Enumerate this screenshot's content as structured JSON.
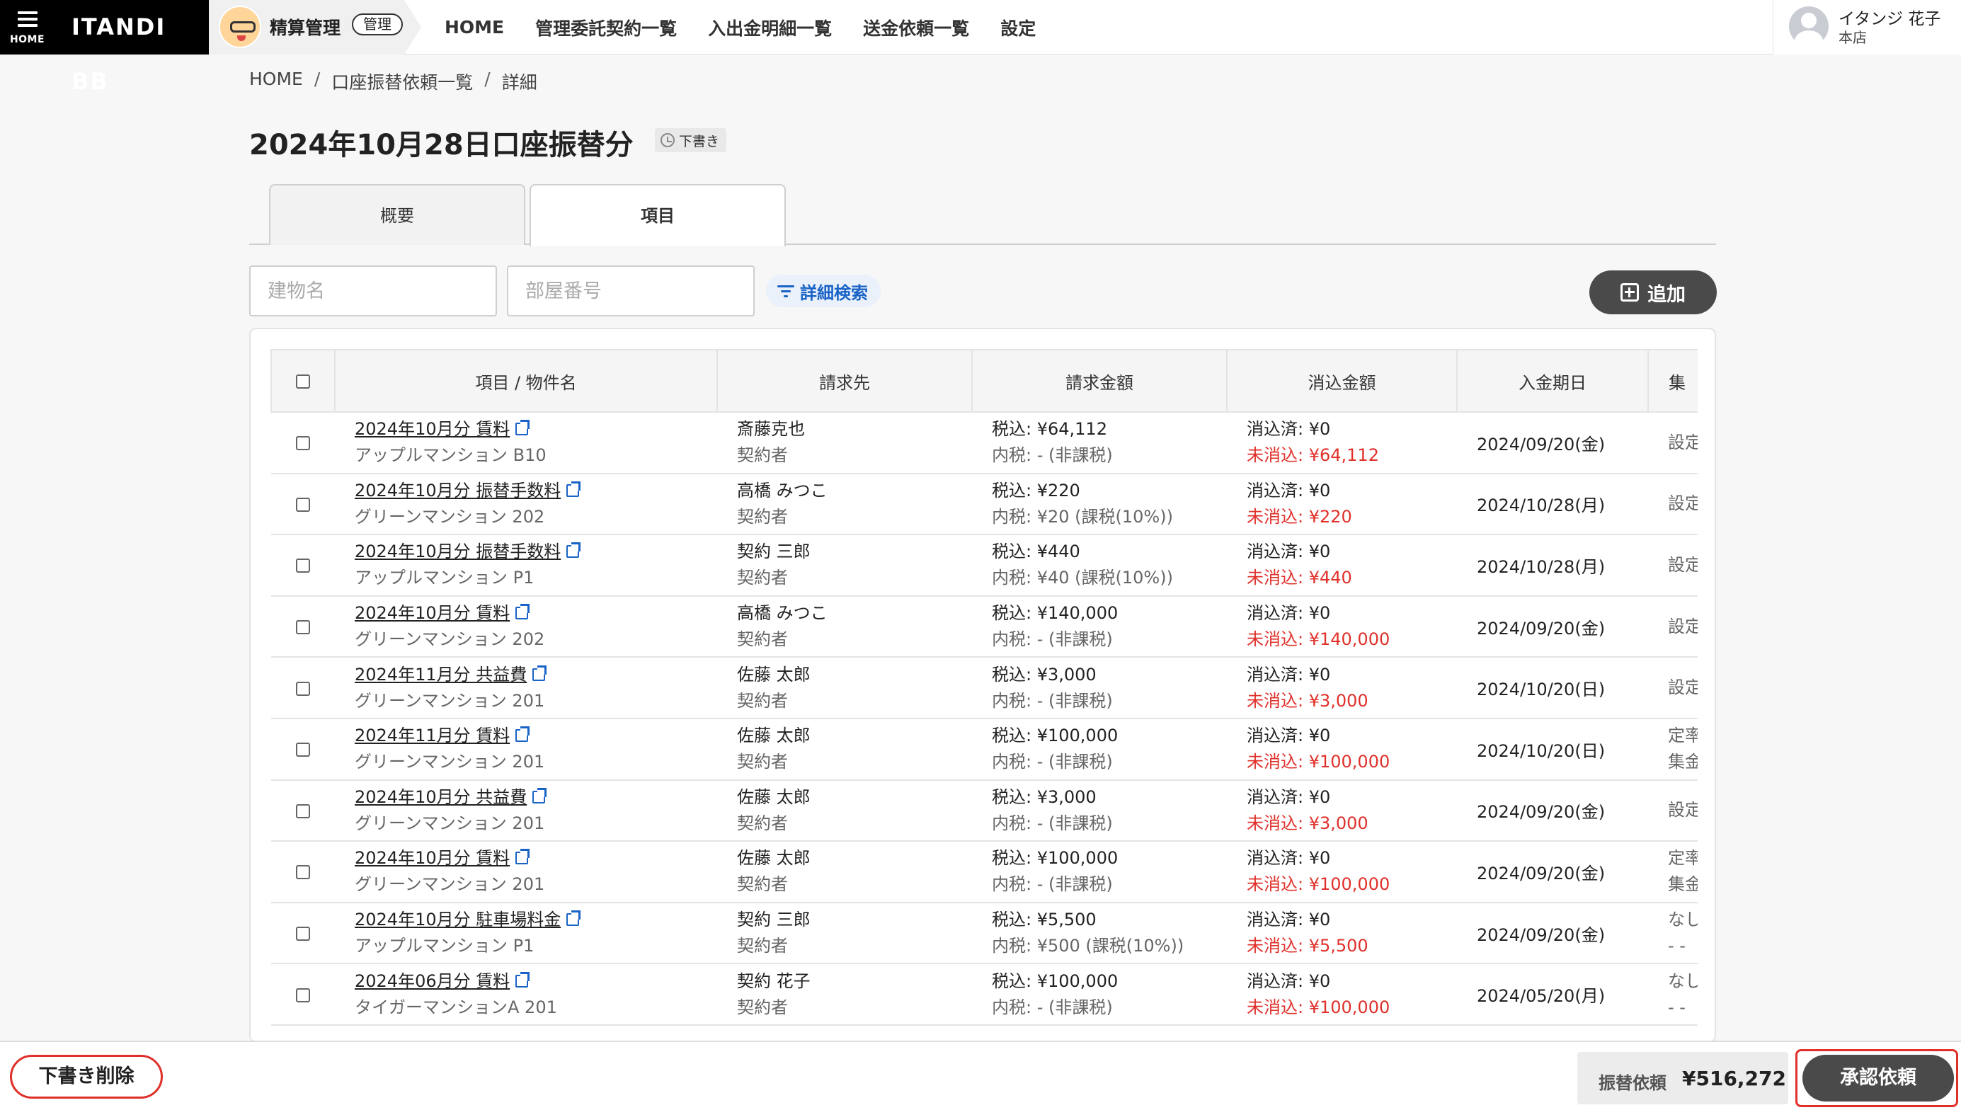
{
  "nav": {
    "home_label": "HOME",
    "brand": "ITANDI BB",
    "product_name": "精算管理",
    "product_badge": "管理",
    "links": [
      "HOME",
      "管理委託契約一覧",
      "入出金明細一覧",
      "送金依頼一覧",
      "設定"
    ],
    "user_name": "イタンジ 花子",
    "user_branch": "本店"
  },
  "breadcrumb": [
    "HOME",
    "口座振替依頼一覧",
    "詳細"
  ],
  "breadcrumb_sep": "/",
  "page_title": "2024年10月28日口座振替分",
  "status_badge": "下書き",
  "tabs": [
    "概要",
    "項目"
  ],
  "filters": {
    "building_placeholder": "建物名",
    "room_placeholder": "部屋番号",
    "advanced_search": "詳細検索",
    "add_label": "追加"
  },
  "table": {
    "headers": [
      "項目 / 物件名",
      "請求先",
      "請求金額",
      "消込金額",
      "入金期日",
      "集"
    ],
    "rows": [
      {
        "item": "2024年10月分 賃料",
        "property": "アップルマンション B10",
        "payer": "斎藤克也",
        "payer_role": "契約者",
        "amount": "税込: ¥64,112",
        "tax": "内税: - (非課税)",
        "cleared": "消込済: ¥0",
        "uncleared": "未消込: ¥64,112",
        "due": "2024/09/20(金)",
        "col6a": "設定",
        "col6b": ""
      },
      {
        "item": "2024年10月分 振替手数料",
        "property": "グリーンマンション 202",
        "payer": "高橋 みつこ",
        "payer_role": "契約者",
        "amount": "税込: ¥220",
        "tax": "内税: ¥20 (課税(10%))",
        "cleared": "消込済: ¥0",
        "uncleared": "未消込: ¥220",
        "due": "2024/10/28(月)",
        "col6a": "設定",
        "col6b": ""
      },
      {
        "item": "2024年10月分 振替手数料",
        "property": "アップルマンション P1",
        "payer": "契約 三郎",
        "payer_role": "契約者",
        "amount": "税込: ¥440",
        "tax": "内税: ¥40 (課税(10%))",
        "cleared": "消込済: ¥0",
        "uncleared": "未消込: ¥440",
        "due": "2024/10/28(月)",
        "col6a": "設定",
        "col6b": ""
      },
      {
        "item": "2024年10月分 賃料",
        "property": "グリーンマンション 202",
        "payer": "高橋 みつこ",
        "payer_role": "契約者",
        "amount": "税込: ¥140,000",
        "tax": "内税: - (非課税)",
        "cleared": "消込済: ¥0",
        "uncleared": "未消込: ¥140,000",
        "due": "2024/09/20(金)",
        "col6a": "設定",
        "col6b": ""
      },
      {
        "item": "2024年11月分 共益費",
        "property": "グリーンマンション 201",
        "payer": "佐藤 太郎",
        "payer_role": "契約者",
        "amount": "税込: ¥3,000",
        "tax": "内税: - (非課税)",
        "cleared": "消込済: ¥0",
        "uncleared": "未消込: ¥3,000",
        "due": "2024/10/20(日)",
        "col6a": "設定",
        "col6b": ""
      },
      {
        "item": "2024年11月分 賃料",
        "property": "グリーンマンション 201",
        "payer": "佐藤 太郎",
        "payer_role": "契約者",
        "amount": "税込: ¥100,000",
        "tax": "内税: - (非課税)",
        "cleared": "消込済: ¥0",
        "uncleared": "未消込: ¥100,000",
        "due": "2024/10/20(日)",
        "col6a": "定率",
        "col6b": "集金"
      },
      {
        "item": "2024年10月分 共益費",
        "property": "グリーンマンション 201",
        "payer": "佐藤 太郎",
        "payer_role": "契約者",
        "amount": "税込: ¥3,000",
        "tax": "内税: - (非課税)",
        "cleared": "消込済: ¥0",
        "uncleared": "未消込: ¥3,000",
        "due": "2024/09/20(金)",
        "col6a": "設定",
        "col6b": ""
      },
      {
        "item": "2024年10月分 賃料",
        "property": "グリーンマンション 201",
        "payer": "佐藤 太郎",
        "payer_role": "契約者",
        "amount": "税込: ¥100,000",
        "tax": "内税: - (非課税)",
        "cleared": "消込済: ¥0",
        "uncleared": "未消込: ¥100,000",
        "due": "2024/09/20(金)",
        "col6a": "定率",
        "col6b": "集金"
      },
      {
        "item": "2024年10月分 駐車場料金",
        "property": "アップルマンション P1",
        "payer": "契約 三郎",
        "payer_role": "契約者",
        "amount": "税込: ¥5,500",
        "tax": "内税: ¥500 (課税(10%))",
        "cleared": "消込済: ¥0",
        "uncleared": "未消込: ¥5,500",
        "due": "2024/09/20(金)",
        "col6a": "なし",
        "col6b": "- -"
      },
      {
        "item": "2024年06月分 賃料",
        "property": "タイガーマンションA 201",
        "payer": "契約 花子",
        "payer_role": "契約者",
        "amount": "税込: ¥100,000",
        "tax": "内税: - (非課税)",
        "cleared": "消込済: ¥0",
        "uncleared": "未消込: ¥100,000",
        "due": "2024/05/20(月)",
        "col6a": "なし",
        "col6b": "- -"
      }
    ]
  },
  "footer": {
    "delete_draft": "下書き削除",
    "total_label": "振替依頼",
    "total_value": "¥516,272",
    "approve_label": "承認依頼"
  },
  "colors": {
    "accent_blue": "#1a63c6",
    "alert_red": "#e0302a",
    "dark_button": "#4a4a4a"
  }
}
